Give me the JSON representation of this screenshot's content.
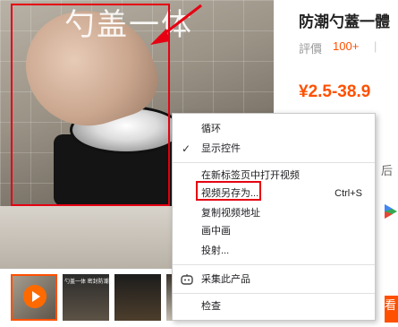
{
  "media": {
    "overlay_text": "勺盖一体"
  },
  "product": {
    "title": "防潮勺蓋一體",
    "rating_label": "評價",
    "rating_count": "100+",
    "price": "¥2.5-38.9",
    "edge_text": "后",
    "buy_label": "看"
  },
  "thumbnails": [
    {
      "caption": ""
    },
    {
      "caption": "勺盖一体 密封防潮"
    },
    {
      "caption": ""
    },
    {
      "caption": ""
    }
  ],
  "context_menu": {
    "items": [
      {
        "label": "循环"
      },
      {
        "label": "显示控件",
        "checked": true
      },
      {
        "label": "在新标签页中打开视频"
      },
      {
        "label": "视频另存为...",
        "shortcut": "Ctrl+S"
      },
      {
        "label": "复制视频地址"
      },
      {
        "label": "画中画"
      },
      {
        "label": "投射..."
      },
      {
        "label": "采集此产品",
        "icon": "robot-icon"
      },
      {
        "label": "检查"
      }
    ]
  },
  "annotations": {
    "arrow_color": "#e60012",
    "frame_color": "#e60012"
  },
  "colors": {
    "accent": "#ff5000"
  }
}
